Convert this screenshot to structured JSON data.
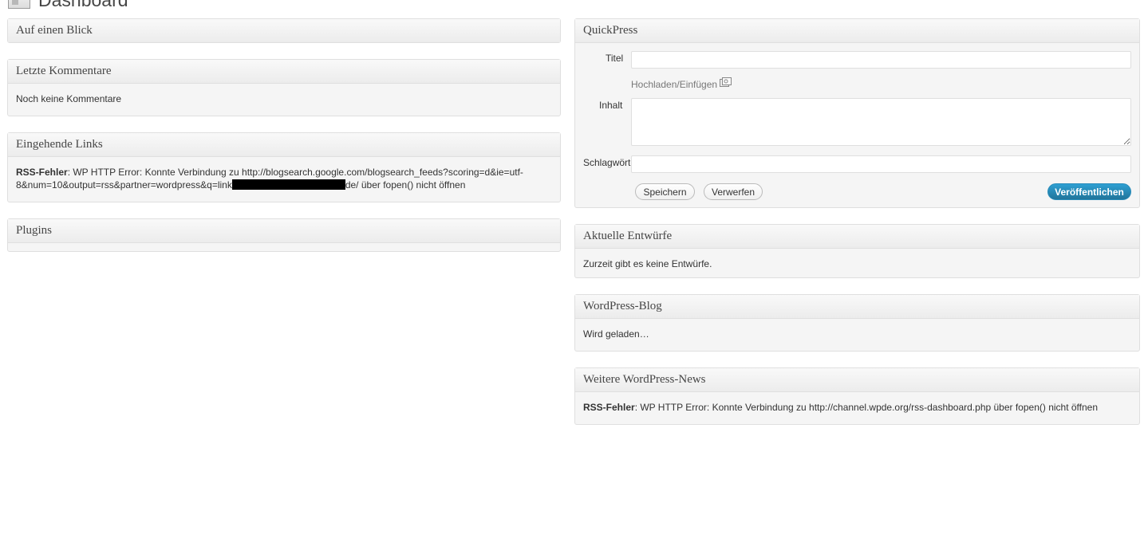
{
  "page": {
    "title": "Dashboard"
  },
  "left": {
    "glance": {
      "title": "Auf einen Blick"
    },
    "comments": {
      "title": "Letzte Kommentare",
      "text": "Noch keine Kommentare"
    },
    "incoming": {
      "title": "Eingehende Links",
      "error_label": "RSS-Fehler",
      "error_text_a": ": WP HTTP Error: Konnte Verbindung zu http://blogsearch.google.com/blogsearch_feeds?scoring=d&ie=utf-8&num=10&output=rss&partner=wordpress&q=link",
      "error_text_b": "de/ über fopen() nicht öffnen"
    },
    "plugins": {
      "title": "Plugins"
    }
  },
  "right": {
    "quickpress": {
      "title": "QuickPress",
      "title_label": "Titel",
      "upload_label": "Hochladen/Einfügen",
      "content_label": "Inhalt",
      "tags_label": "Schlagwörter",
      "title_value": "",
      "content_value": "",
      "tags_value": "",
      "save_label": "Speichern",
      "discard_label": "Verwerfen",
      "publish_label": "Veröffentlichen"
    },
    "drafts": {
      "title": "Aktuelle Entwürfe",
      "text": "Zurzeit gibt es keine Entwürfe."
    },
    "blog": {
      "title": "WordPress-Blog",
      "text": "Wird geladen…"
    },
    "news": {
      "title": "Weitere WordPress-News",
      "error_label": "RSS-Fehler",
      "error_text": ": WP HTTP Error: Konnte Verbindung zu http://channel.wpde.org/rss-dashboard.php über fopen() nicht öffnen"
    }
  },
  "colors": {
    "publish_button": "#21759b",
    "box_border": "#dfdfdf",
    "box_bg": "#f5f5f5"
  },
  "icons": {
    "dashboard": "dashboard-icon",
    "media": "media-upload-icon"
  }
}
